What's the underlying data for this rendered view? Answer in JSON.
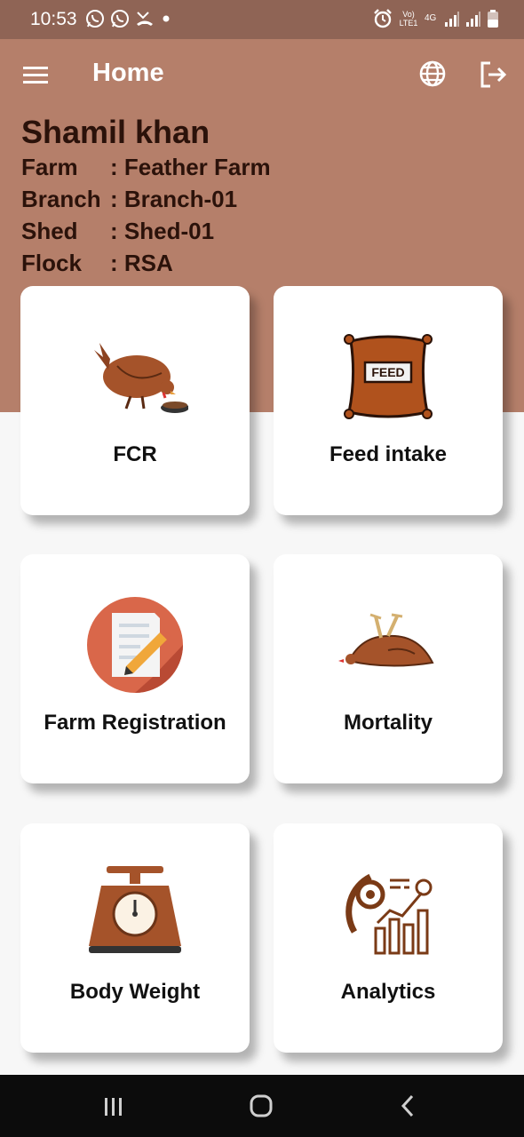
{
  "status_bar": {
    "time": "10:53",
    "left_icons": [
      "whatsapp-icon",
      "whatsapp-icon",
      "missed-call-icon",
      "dot-icon"
    ],
    "right_icons": [
      "alarm-icon",
      "volte-icon",
      "4g-icon",
      "signal-icon",
      "signal-icon",
      "battery-icon"
    ],
    "volte_text": "Vo) LTE1",
    "network_text": "4G"
  },
  "app_bar": {
    "title": "Home"
  },
  "profile": {
    "name": "Shamil khan",
    "rows": [
      {
        "key": "Farm",
        "value": ": Feather Farm"
      },
      {
        "key": "Branch",
        "value": ": Branch-01"
      },
      {
        "key": "Shed",
        "value": ": Shed-01"
      },
      {
        "key": "Flock",
        "value": ": RSA"
      }
    ]
  },
  "cards": [
    {
      "label": "FCR",
      "icon": "hen-eating-icon"
    },
    {
      "label": "Feed intake",
      "icon": "feed-bag-icon"
    },
    {
      "label": "Farm Registration",
      "icon": "registration-form-icon"
    },
    {
      "label": "Mortality",
      "icon": "dead-chicken-icon"
    },
    {
      "label": "Body Weight",
      "icon": "weighing-scale-icon"
    },
    {
      "label": "Analytics",
      "icon": "analytics-chart-icon"
    }
  ],
  "feed_bag_text": "FEED",
  "colors": {
    "status_bar": "#8f6455",
    "header": "#b57f6a",
    "brown_icon": "#a5532a",
    "nav_bar": "#0c0c0c"
  }
}
